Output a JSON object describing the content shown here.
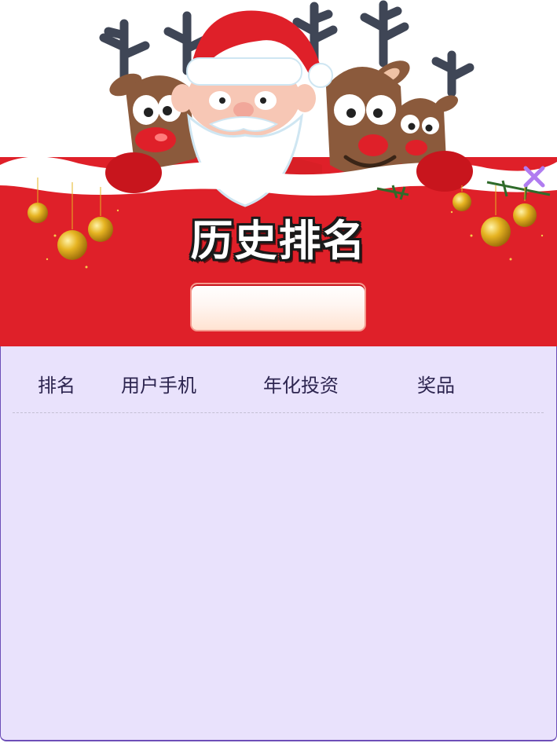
{
  "modal": {
    "title": "历史排名",
    "period_value": "",
    "close_icon": "close-x-icon"
  },
  "table": {
    "headers": [
      "排名",
      "用户手机",
      "年化投资",
      "奖品"
    ],
    "rows": []
  },
  "colors": {
    "banner_red": "#df2029",
    "panel_lavender": "#e9e2fc",
    "panel_border": "#6d4fb8",
    "close_purple": "#b07cf0",
    "header_text": "#2d2550"
  }
}
